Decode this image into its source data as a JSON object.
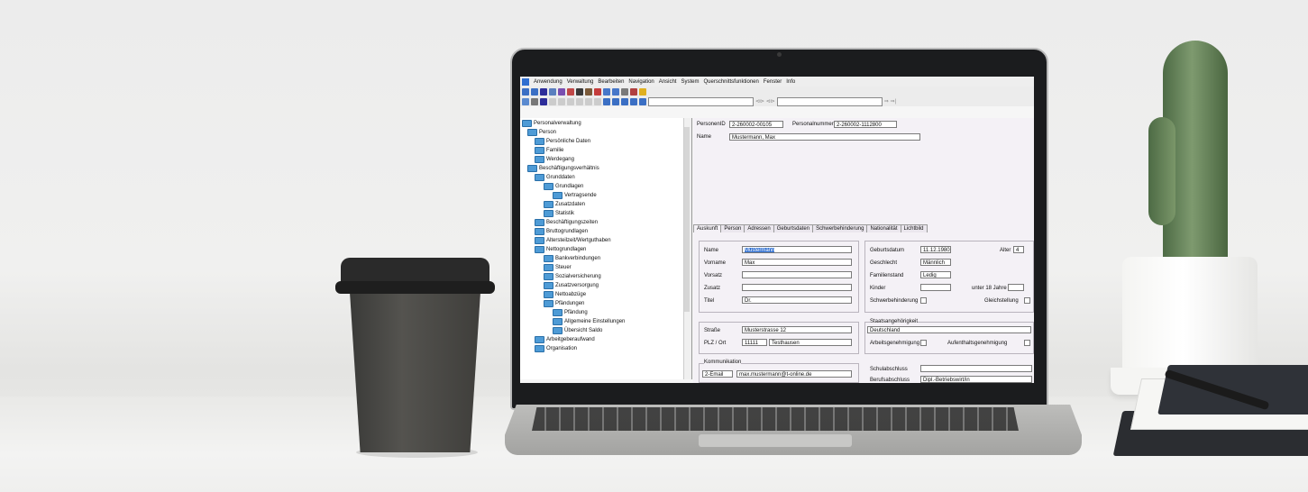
{
  "menu": [
    "Anwendung",
    "Verwaltung",
    "Bearbeiten",
    "Navigation",
    "Ansicht",
    "System",
    "Querschnittsfunktionen",
    "Fenster",
    "Info"
  ],
  "toolbar_nav": "⊲⊳ ⊲⊳",
  "toolbar_nav2": "⇒ ⇒|",
  "tree": [
    {
      "label": "Personalverwaltung",
      "level": 0
    },
    {
      "label": "Person",
      "level": 1
    },
    {
      "label": "Persönliche Daten",
      "level": 2
    },
    {
      "label": "Familie",
      "level": 2
    },
    {
      "label": "Werdegang",
      "level": 2
    },
    {
      "label": "Beschäftigungsverhältnis",
      "level": 1
    },
    {
      "label": "Grunddaten",
      "level": 2
    },
    {
      "label": "Grundlagen",
      "level": 3
    },
    {
      "label": "Vertragsende",
      "level": 4
    },
    {
      "label": "Zusatzdaten",
      "level": 3
    },
    {
      "label": "Statistik",
      "level": 3
    },
    {
      "label": "Beschäftigungszeiten",
      "level": 2
    },
    {
      "label": "Bruttogrundlagen",
      "level": 2
    },
    {
      "label": "Altersteilzeit/Wertguthaben",
      "level": 2
    },
    {
      "label": "Nettogrundlagen",
      "level": 2
    },
    {
      "label": "Bankverbindungen",
      "level": 3
    },
    {
      "label": "Steuer",
      "level": 3
    },
    {
      "label": "Sozialversicherung",
      "level": 3
    },
    {
      "label": "Zusatzversorgung",
      "level": 3
    },
    {
      "label": "Nettoabzüge",
      "level": 3
    },
    {
      "label": "Pfändungen",
      "level": 3
    },
    {
      "label": "Pfändung",
      "level": 4
    },
    {
      "label": "Allgemeine Einstellungen",
      "level": 4
    },
    {
      "label": "Übersicht Saldo",
      "level": 4
    },
    {
      "label": "Arbeitgeberaufwand",
      "level": 2
    },
    {
      "label": "Organisation",
      "level": 2
    }
  ],
  "header": {
    "personen_id_label": "PersonenID",
    "personen_id": "2-260002-00105",
    "personalnummer_label": "Personalnummer",
    "personalnummer": "2-260002-1112800",
    "name_label": "Name",
    "name": "Mustermann, Max"
  },
  "tabs": [
    "Auskunft",
    "Person",
    "Adressen",
    "Geburtsdaten",
    "Schwerbehinderung",
    "Nationalität",
    "Lichtbild"
  ],
  "person": {
    "name_label": "Name",
    "name": "Mustermann",
    "vorname_label": "Vorname",
    "vorname": "Max",
    "vorsatz_label": "Vorsatz",
    "vorsatz": "",
    "zusatz_label": "Zusatz",
    "zusatz": "",
    "titel_label": "Titel",
    "titel": "Dr."
  },
  "details": {
    "geburtsdatum_label": "Geburtsdatum",
    "geburtsdatum": "11.12.1980",
    "alter_label": "Alter",
    "alter": "4",
    "geschlecht_label": "Geschlecht",
    "geschlecht": "Männlich",
    "familienstand_label": "Familienstand",
    "familienstand": "Ledig",
    "kinder_label": "Kinder",
    "kinder": "",
    "unter18_label": "unter 18 Jahre",
    "unter18": "",
    "schwerbehinderung_label": "Schwerbehinderung",
    "gleichstellung_label": "Gleichstellung"
  },
  "address": {
    "strasse_label": "Straße",
    "strasse": "Musterstrasse 12",
    "plz_label": "PLZ / Ort",
    "plz": "11111",
    "ort": "Testhausen"
  },
  "citizenship": {
    "staatsangehoerigkeit_label": "Staatsangehörigkeit",
    "staatsangehoerigkeit": "Deutschland",
    "arbeitsgenehmigung_label": "Arbeitsgenehmigung",
    "aufenthaltsgenehmigung_label": "Aufenthaltsgenehmigung"
  },
  "communication": {
    "group_label": "Kommunikation",
    "type": "2-Email",
    "value": "max.mustermann@t-online.de"
  },
  "education": {
    "schulabschluss_label": "Schulabschluss",
    "schulabschluss": "",
    "berufsabschluss_label": "Berufsabschluss",
    "berufsabschluss": "Dipl.-Betriebswirt/in"
  },
  "colors": {
    "accent": "#2f6ed0",
    "folder": "#4e9bd6",
    "pane_bg": "#f4f1f6"
  }
}
